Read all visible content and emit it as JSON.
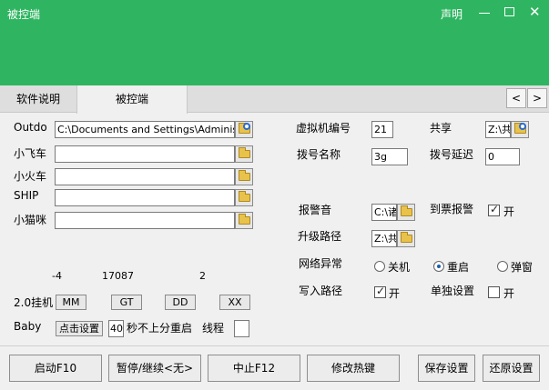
{
  "window": {
    "title": "被控端",
    "statement_label": "声明"
  },
  "tabs": [
    "软件说明",
    "被控端"
  ],
  "left": {
    "outdo_label": "Outdo",
    "outdo_value": "C:\\Documents and Settings\\Administrato",
    "car_label": "小飞车",
    "car_value": "",
    "train_label": "小火车",
    "train_value": "",
    "ship_label": "SHIP",
    "ship_value": "",
    "cat_label": "小猫咪",
    "cat_value": "",
    "numbers": [
      "-4",
      "17087",
      "2"
    ],
    "hang_label": "2.0挂机",
    "hang_buttons": [
      "MM",
      "GT",
      "DD",
      "XX"
    ],
    "baby_label": "Baby",
    "click_setup": "点击设置",
    "seconds_value": "40",
    "restart_label": "秒不上分重启",
    "thread_label": "线程",
    "thread_value": ""
  },
  "right": {
    "vm_label": "虚拟机编号",
    "vm_value": "21",
    "share_label": "共享",
    "share_value": "Z:\\共",
    "dial_name_label": "拨号名称",
    "dial_name_value": "3g",
    "dial_delay_label": "拨号延迟",
    "dial_delay_value": "0",
    "alarm_sound_label": "报警音",
    "alarm_sound_value": "C:\\诸",
    "ticket_alarm_label": "到票报警",
    "ticket_alarm_option": "开",
    "upgrade_label": "升级路径",
    "upgrade_value": "Z:\\共",
    "net_error_label": "网络异常",
    "net_options": [
      "关机",
      "重启",
      "弹窗"
    ],
    "net_selected": "重启",
    "write_path_label": "写入路径",
    "write_path_option": "开",
    "single_setting_label": "单独设置",
    "single_setting_option": "开"
  },
  "bottom": [
    "启动F10",
    "暂停/继续<无>",
    "中止F12",
    "修改热键",
    "保存设置",
    "还原设置"
  ],
  "colors": {
    "titlebar": "#2fb561",
    "tabstrip": "#dedede",
    "background": "#f0f0f0"
  },
  "icons": {
    "minimize": "minimize-icon",
    "maximize": "maximize-icon",
    "close": "close-icon",
    "folder": "folder-open-icon",
    "search_folder": "folder-search-icon"
  }
}
